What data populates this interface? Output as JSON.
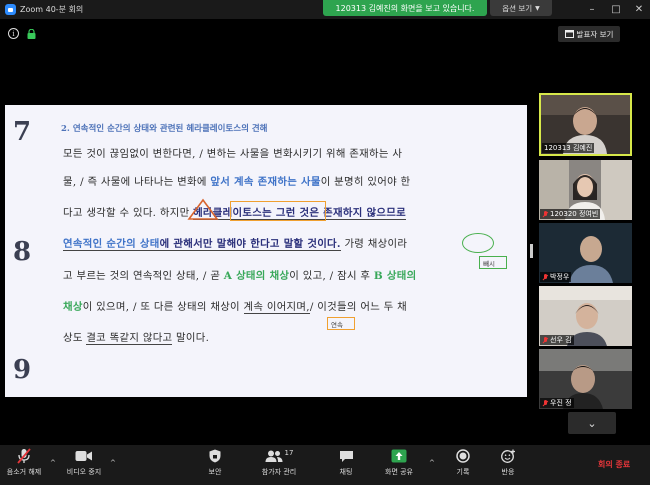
{
  "window": {
    "title": "Zoom 40-분 회의"
  },
  "share_banner": {
    "text": "120313 김예진의 화면을 보고 있습니다.",
    "options_label": "옵션 보기"
  },
  "view": {
    "speaker_view_label": "발표자 보기"
  },
  "document": {
    "margin_numbers": [
      "7",
      "8",
      "9"
    ],
    "heading": "2. 연속적인 순간의 상태와 관련된 헤라클레이토스의 견해",
    "lines": [
      [
        "모든 것이 끊임없이 변한다면, / 변하는 사물을 변화시키기 위해 존재하는 사"
      ],
      [
        "물, / 즉 사물에 나타나는 변화에 ",
        "앞서 계속 존재하는 사물",
        "이 분명히 있어야 한"
      ],
      [
        "다고 생각할 수 있다. ",
        "하지만",
        " ",
        "헤라클레이토스는 그런 것은 존재하지 않으므로"
      ],
      [
        "연속적인 순간의 상태",
        "에 관해서만 말해야 한다고 말할 것이다.",
        " 가령 ",
        "채상",
        "이라"
      ],
      [
        "고 부르는 것의 연속적인 상태, / 곧 ",
        "A 상태의 채상",
        "이 있고, / 잠시 후 ",
        "B 상태의"
      ],
      [
        "채상",
        "이 있으며, / 또 다른 상태의 채상이 ",
        "계속 이어지며,",
        "/ 이것들의 어느 두 채"
      ],
      [
        "상도 ",
        "결코 똑같지 않다고",
        " 말이다."
      ]
    ],
    "annotations": {
      "chaesang_note": "빼시",
      "gyesok_note": "연속"
    }
  },
  "participants": [
    {
      "name": "120313 김예진",
      "muted": false,
      "active": true
    },
    {
      "name": "120320 정여빈",
      "muted": true,
      "active": false
    },
    {
      "name": "박정우",
      "muted": true,
      "active": false
    },
    {
      "name": "선우 김",
      "muted": true,
      "active": false
    },
    {
      "name": "우진 정",
      "muted": true,
      "active": false
    }
  ],
  "toolbar": {
    "mute_label": "음소거 해제",
    "video_label": "비디오 중지",
    "security_label": "보안",
    "participants_label": "참가자 관리",
    "participants_count": "17",
    "chat_label": "채팅",
    "share_label": "화면 공유",
    "record_label": "기록",
    "reactions_label": "반응",
    "end_label": "회의 종료"
  },
  "colors": {
    "accent_blue": "#2d8cff",
    "share_green": "#2ea44f",
    "end_red": "#e5363a",
    "annotation_orange": "#f0a030",
    "annotation_green": "#49b04e"
  }
}
